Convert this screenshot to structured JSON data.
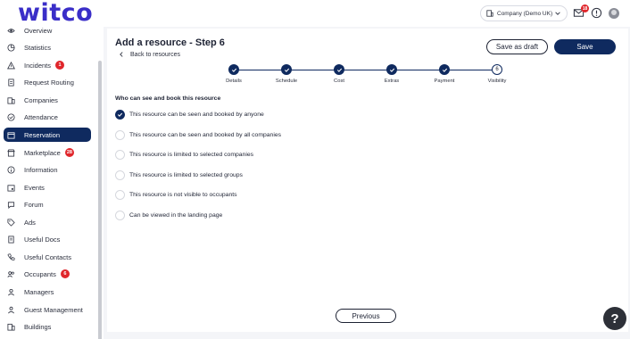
{
  "header": {
    "logo": "witco",
    "company_select": "Company (Demo UK)",
    "mail_badge": "18"
  },
  "sidebar": {
    "items": [
      {
        "label": "Overview",
        "icon": "eye-icon"
      },
      {
        "label": "Statistics",
        "icon": "pie-chart-icon"
      },
      {
        "label": "Incidents",
        "icon": "warning-icon",
        "badge": "1"
      },
      {
        "label": "Request Routing",
        "icon": "document-icon"
      },
      {
        "label": "Companies",
        "icon": "building-icon"
      },
      {
        "label": "Attendance",
        "icon": "check-circle-icon"
      },
      {
        "label": "Reservation",
        "icon": "calendar-icon",
        "active": true
      },
      {
        "label": "Marketplace",
        "icon": "shop-icon",
        "badge": "28"
      },
      {
        "label": "Information",
        "icon": "info-icon"
      },
      {
        "label": "Events",
        "icon": "calendar-event-icon"
      },
      {
        "label": "Forum",
        "icon": "chat-icon"
      },
      {
        "label": "Ads",
        "icon": "tag-icon"
      },
      {
        "label": "Useful Docs",
        "icon": "doc-icon"
      },
      {
        "label": "Useful Contacts",
        "icon": "phone-icon"
      },
      {
        "label": "Occupants",
        "icon": "users-icon",
        "badge": "6"
      },
      {
        "label": "Managers",
        "icon": "user-icon"
      },
      {
        "label": "Guest Management",
        "icon": "guest-icon"
      },
      {
        "label": "Buildings",
        "icon": "buildings-icon"
      }
    ]
  },
  "main": {
    "title": "Add a resource - Step 6",
    "back_label": "Back to resources",
    "save_draft_label": "Save as draft",
    "save_label": "Save",
    "steps": [
      {
        "label": "Details",
        "done": true
      },
      {
        "label": "Schedule",
        "done": true
      },
      {
        "label": "Cost",
        "done": true
      },
      {
        "label": "Extras",
        "done": true
      },
      {
        "label": "Payment",
        "done": true
      },
      {
        "label": "Visibility",
        "done": false,
        "number": "6"
      }
    ],
    "section_title": "Who can see and book this resource",
    "options": [
      {
        "label": "This resource can be seen and booked by anyone",
        "checked": true
      },
      {
        "label": "This resource can be seen and booked by all companies",
        "checked": false
      },
      {
        "label": "This resource is limited to selected companies",
        "checked": false
      },
      {
        "label": "This resource is limited to selected groups",
        "checked": false
      },
      {
        "label": "This resource is not visible to occupants",
        "checked": false
      },
      {
        "label": "Can be viewed in the landing page",
        "checked": false
      }
    ],
    "previous_label": "Previous"
  },
  "help_label": "?",
  "colors": {
    "brand": "#3a2ec8",
    "primary": "#0f2a5f",
    "badge": "#e0262b"
  }
}
